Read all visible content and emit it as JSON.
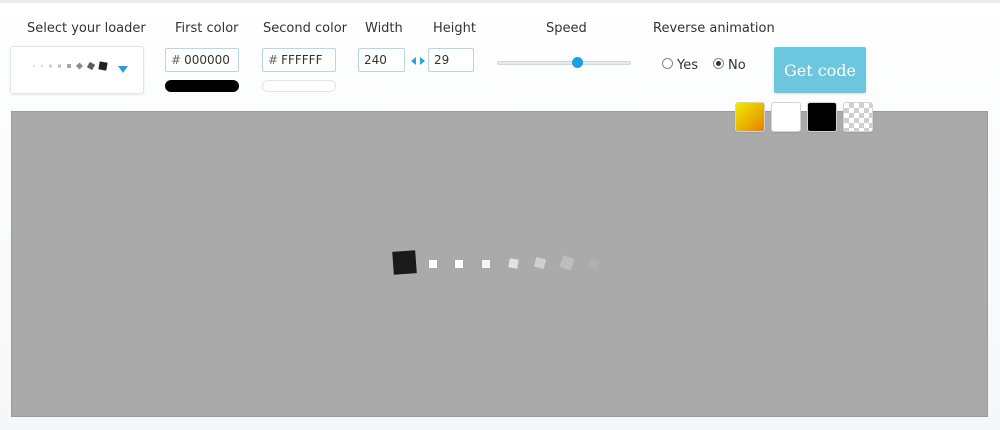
{
  "toolbar": {
    "select_loader_label": "Select your loader",
    "first_color_label": "First color",
    "second_color_label": "Second color",
    "width_label": "Width",
    "height_label": "Height",
    "speed_label": "Speed",
    "reverse_label": "Reverse animation"
  },
  "first_color": {
    "hash": "#",
    "value": "000000",
    "swatch": "#000000"
  },
  "second_color": {
    "hash": "#",
    "value": "FFFFFF",
    "swatch": "#FFFFFF"
  },
  "size": {
    "width": "240",
    "height": "29"
  },
  "speed": {
    "value": 0.6
  },
  "reverse": {
    "yes_label": "Yes",
    "no_label": "No",
    "selected": "No"
  },
  "get_code_label": "Get code",
  "backgrounds": [
    "yellow-gradient",
    "white",
    "black",
    "transparent"
  ],
  "colors": {
    "accent": "#1ea0e0",
    "button": "#6cc6de",
    "stage": "#aaaaaa"
  }
}
